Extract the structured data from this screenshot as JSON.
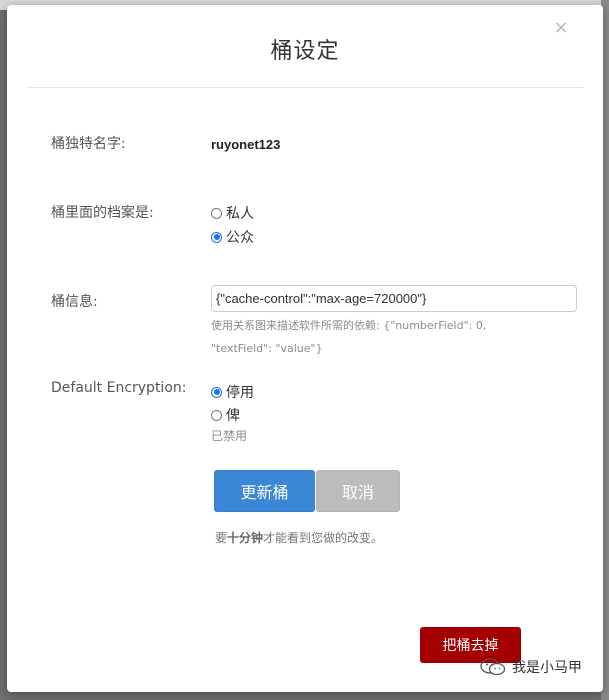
{
  "modal": {
    "title": "桶设定",
    "close_glyph": "×"
  },
  "bucket_name": {
    "label": "桶独特名字:",
    "value": "ruyonet123"
  },
  "visibility": {
    "label": "桶里面的档案是:",
    "options": [
      {
        "label": "私人",
        "checked": false
      },
      {
        "label": "公众",
        "checked": true
      }
    ]
  },
  "bucket_info": {
    "label": "桶信息:",
    "value": "{\"cache-control\":\"max-age=720000\"}",
    "help_line1": "使用关系图来描述软件所需的依赖: {\"numberField\": 0,",
    "help_line2": "\"textField\": \"value\"}"
  },
  "encryption": {
    "label": "Default Encryption:",
    "options": [
      {
        "label": "停用",
        "checked": true
      },
      {
        "label": "俾",
        "checked": false
      }
    ],
    "status": "已禁用"
  },
  "actions": {
    "update_label": "更新桶",
    "cancel_label": "取消",
    "delete_label": "把桶去掉"
  },
  "note": {
    "prefix": "要",
    "emphasis": "十分钟",
    "suffix": "才能看到您做的改变。"
  },
  "watermark": {
    "text": "我是小马甲"
  },
  "colors": {
    "primary": "#3b87d6",
    "cancel": "#bcbcbc",
    "danger": "#a40000",
    "radio_checked": "#1a73e8"
  }
}
